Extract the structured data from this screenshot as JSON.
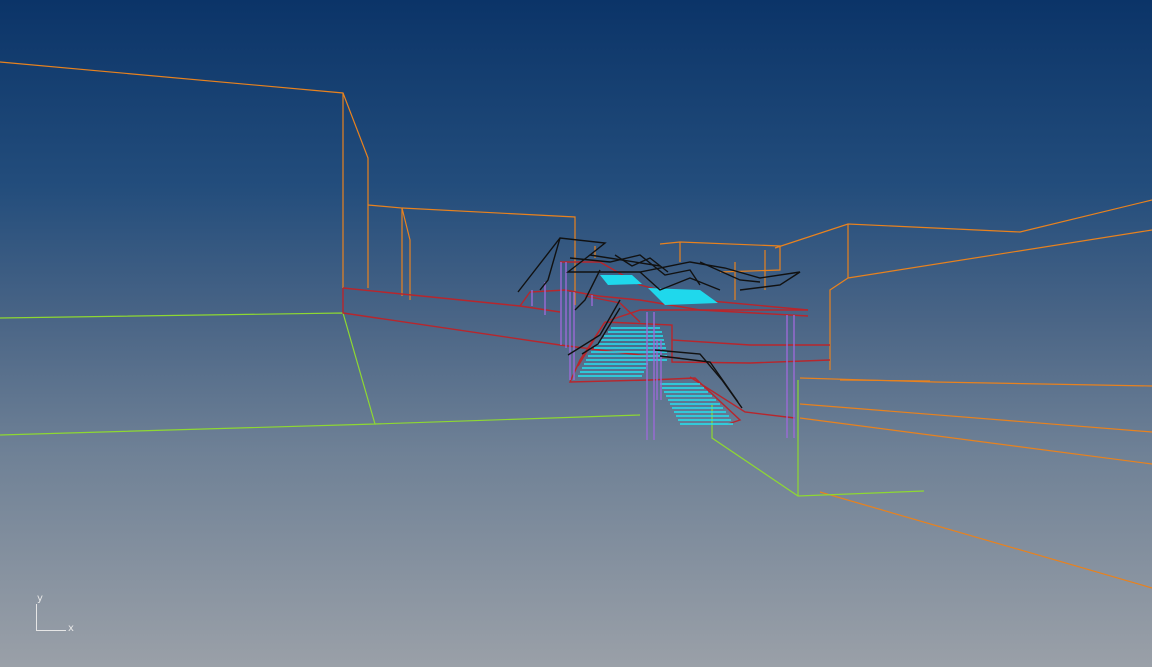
{
  "viewport": {
    "axis_y_label": "y",
    "axis_x_label": "x"
  },
  "colors": {
    "background_top": "#0b3468",
    "background_bottom": "#9aa0a8",
    "building_wireframe": "#e8821e",
    "ground_outline": "#8ed832",
    "structure_edges": "#b8262c",
    "roof_canopy": "#111111",
    "columns": "#9b6ad6",
    "stair_treads": "#22e4f2"
  }
}
